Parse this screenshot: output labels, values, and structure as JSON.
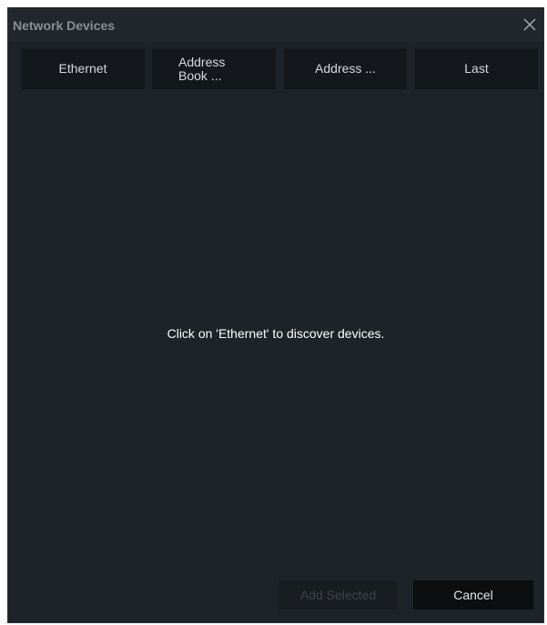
{
  "window": {
    "title": "Network Devices"
  },
  "tabs": [
    {
      "label": "Ethernet"
    },
    {
      "label": "Address Book ..."
    },
    {
      "label": "Address ..."
    },
    {
      "label": "Last"
    }
  ],
  "main": {
    "empty_message": "Click on 'Ethernet' to discover devices."
  },
  "footer": {
    "add_selected_label": "Add Selected",
    "cancel_label": "Cancel"
  },
  "icons": {
    "close": "close-icon"
  },
  "colors": {
    "background": "#1e2329",
    "titlebar": "#22272d",
    "tab_background": "#14171b",
    "disabled_text": "#3d444c"
  }
}
